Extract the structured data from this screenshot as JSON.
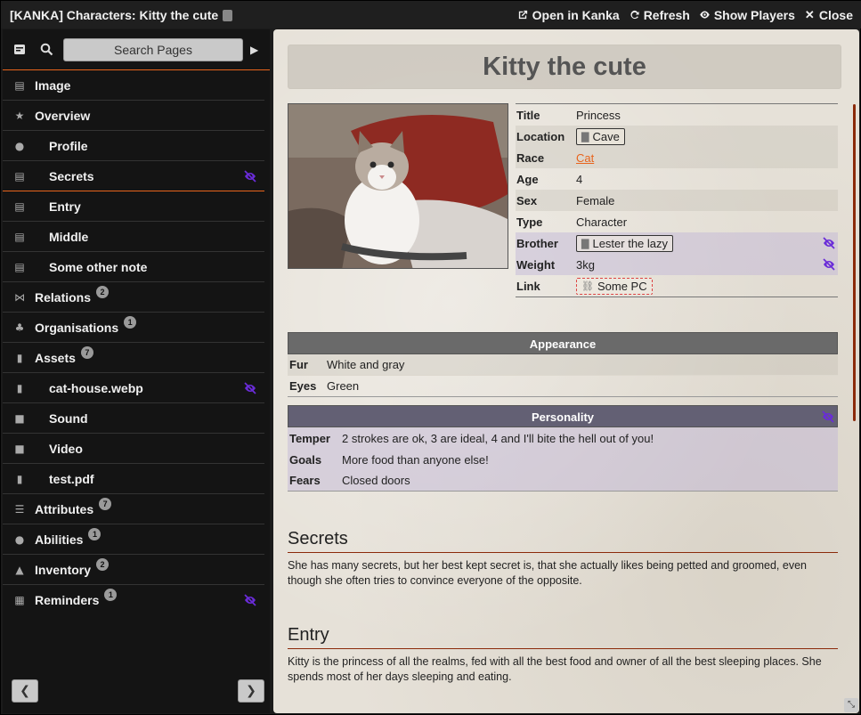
{
  "window": {
    "title": "[KANKA] Characters: Kitty the cute",
    "actions": {
      "open": "Open in Kanka",
      "refresh": "Refresh",
      "show_players": "Show Players",
      "close": "Close"
    }
  },
  "sidebar": {
    "search_label": "Search Pages",
    "items": [
      {
        "label": "Image",
        "icon": "image-icon",
        "child": false
      },
      {
        "label": "Overview",
        "icon": "star-icon",
        "child": false
      },
      {
        "label": "Profile",
        "icon": "user-icon",
        "child": true
      },
      {
        "label": "Secrets",
        "icon": "note-icon",
        "child": true,
        "hidden": true
      },
      {
        "label": "Entry",
        "icon": "note-icon",
        "child": true
      },
      {
        "label": "Middle",
        "icon": "note-icon",
        "child": true
      },
      {
        "label": "Some other note",
        "icon": "note-icon",
        "child": true
      },
      {
        "label": "Relations",
        "icon": "network-icon",
        "child": false,
        "badge": "2"
      },
      {
        "label": "Organisations",
        "icon": "org-icon",
        "child": false,
        "badge": "1"
      },
      {
        "label": "Assets",
        "icon": "file-icon",
        "child": false,
        "badge": "7"
      },
      {
        "label": "cat-house.webp",
        "icon": "image-file-icon",
        "child": true,
        "hidden": true
      },
      {
        "label": "Sound",
        "icon": "video-icon",
        "child": true
      },
      {
        "label": "Video",
        "icon": "video-icon",
        "child": true
      },
      {
        "label": "test.pdf",
        "icon": "pdf-icon",
        "child": true
      },
      {
        "label": "Attributes",
        "icon": "list-icon",
        "child": false,
        "badge": "7"
      },
      {
        "label": "Abilities",
        "icon": "fire-icon",
        "child": false,
        "badge": "1"
      },
      {
        "label": "Inventory",
        "icon": "bag-icon",
        "child": false,
        "badge": "2"
      },
      {
        "label": "Reminders",
        "icon": "calendar-icon",
        "child": false,
        "badge": "1",
        "hidden": true
      }
    ]
  },
  "character": {
    "name": "Kitty the cute",
    "fields": {
      "title": {
        "k": "Title",
        "v": "Princess"
      },
      "location": {
        "k": "Location",
        "v": "Cave"
      },
      "race": {
        "k": "Race",
        "v": "Cat"
      },
      "age": {
        "k": "Age",
        "v": "4"
      },
      "sex": {
        "k": "Sex",
        "v": "Female"
      },
      "type": {
        "k": "Type",
        "v": "Character"
      },
      "brother": {
        "k": "Brother",
        "v": "Lester the lazy"
      },
      "weight": {
        "k": "Weight",
        "v": "3kg"
      },
      "link": {
        "k": "Link",
        "v": "Some PC"
      }
    }
  },
  "appearance": {
    "header": "Appearance",
    "rows": [
      {
        "k": "Fur",
        "v": "White and gray"
      },
      {
        "k": "Eyes",
        "v": "Green"
      }
    ]
  },
  "personality": {
    "header": "Personality",
    "rows": [
      {
        "k": "Temper",
        "v": "2 strokes are ok, 3 are ideal, 4 and I'll bite the hell out of you!"
      },
      {
        "k": "Goals",
        "v": "More food than anyone else!"
      },
      {
        "k": "Fears",
        "v": "Closed doors"
      }
    ]
  },
  "sections": {
    "secrets": {
      "title": "Secrets",
      "text": "She has many secrets, but her best kept secret is, that she actually likes being petted and groomed, even though she often tries to convince everyone of the opposite."
    },
    "entry": {
      "title": "Entry",
      "text": "Kitty is the princess of all the realms, fed with all the best food and owner of all the best sleeping places. She spends most of her days sleeping and eating."
    }
  },
  "colors": {
    "accent": "#e8641c",
    "hidden_eye": "#6a2cd8",
    "section_rule": "#8b2a0a"
  }
}
